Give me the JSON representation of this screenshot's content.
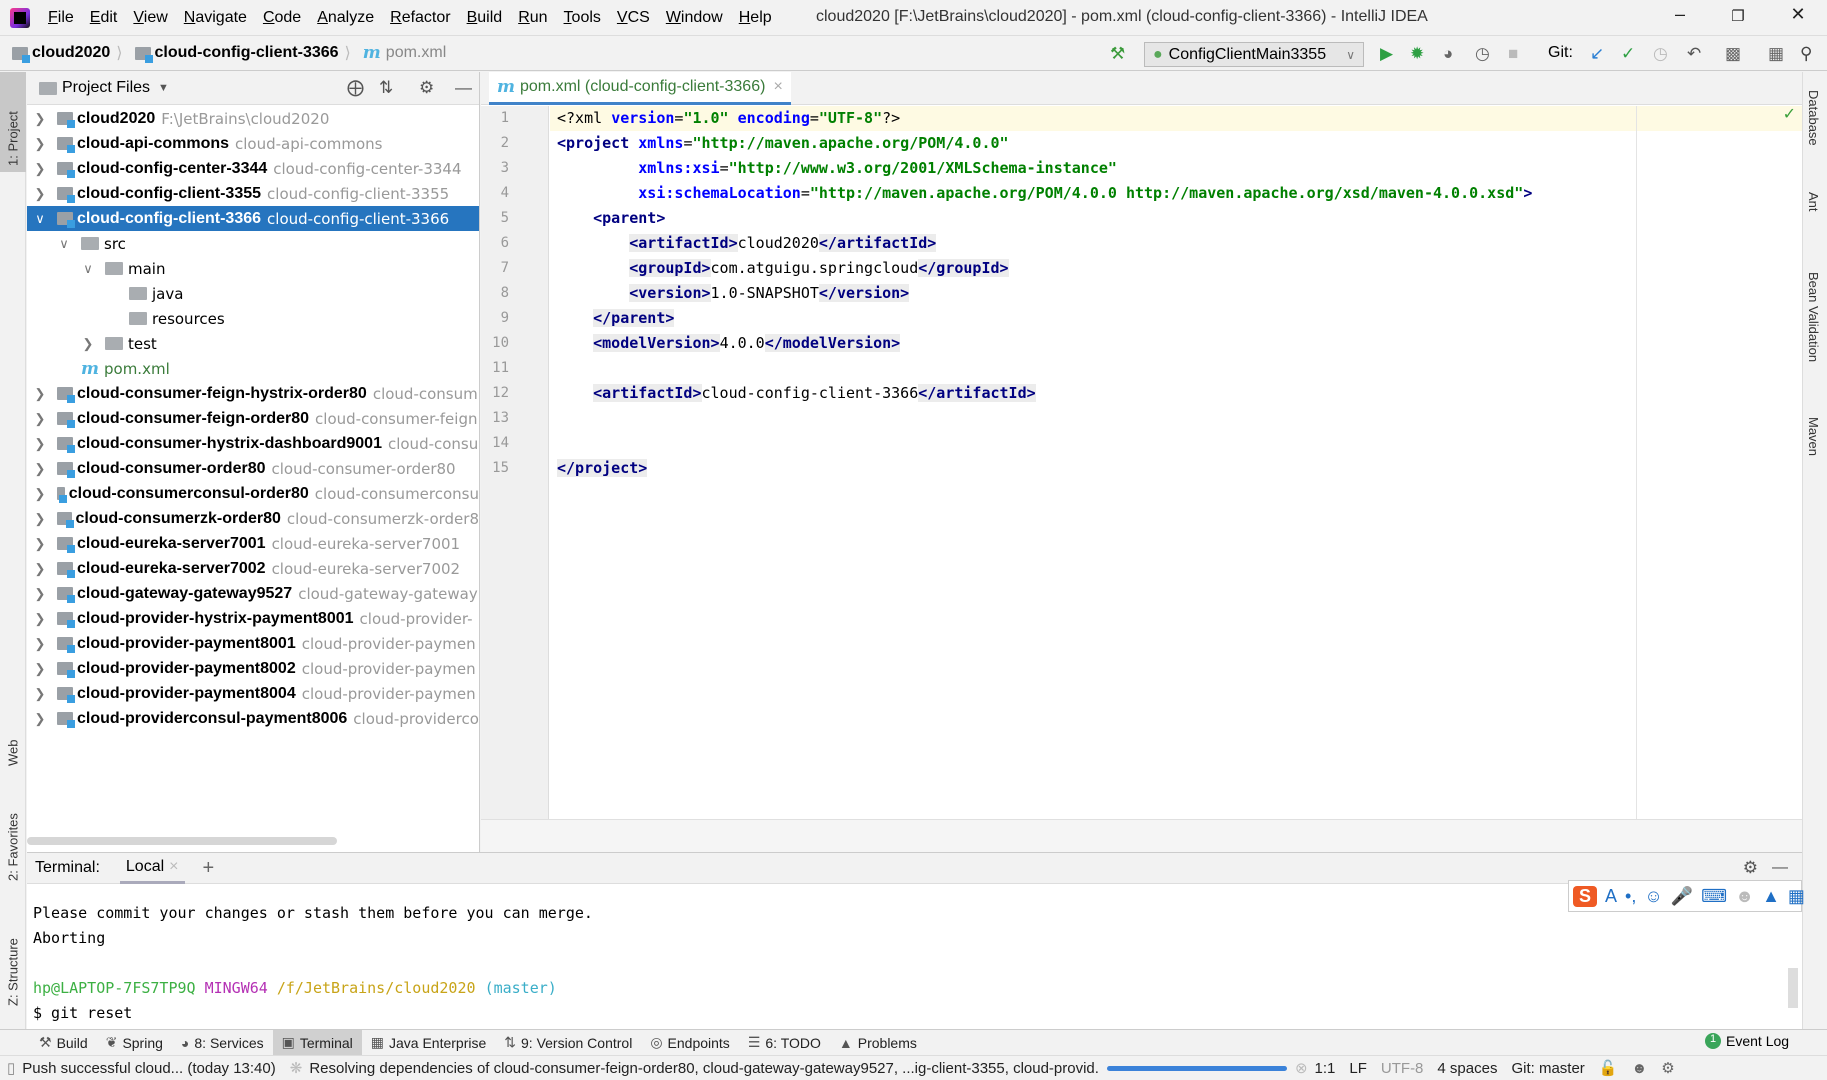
{
  "titlebar": {
    "menus": [
      "File",
      "Edit",
      "View",
      "Navigate",
      "Code",
      "Analyze",
      "Refactor",
      "Build",
      "Run",
      "Tools",
      "VCS",
      "Window",
      "Help"
    ],
    "title": "cloud2020 [F:\\JetBrains\\cloud2020] - pom.xml (cloud-config-client-3366) - IntelliJ IDEA"
  },
  "navbar": {
    "crumbs": [
      "cloud2020",
      "cloud-config-client-3366",
      "pom.xml"
    ],
    "run_config": "ConfigClientMain3355",
    "git_label": "Git:"
  },
  "left_stripe": {
    "project": "1: Project",
    "web": "Web",
    "favorites": "2: Favorites",
    "structure": "Z: Structure"
  },
  "right_stripe": {
    "database": "Database",
    "ant": "Ant",
    "bean": "Bean Validation",
    "maven": "Maven"
  },
  "project": {
    "header": "Project Files",
    "rows": [
      {
        "name": "cloud2020",
        "hint": "F:\\JetBrains\\cloud2020",
        "level": 0,
        "type": "module",
        "expand": "closed"
      },
      {
        "name": "cloud-api-commons",
        "hint": "cloud-api-commons",
        "level": 0,
        "type": "module",
        "expand": "closed"
      },
      {
        "name": "cloud-config-center-3344",
        "hint": "cloud-config-center-3344",
        "level": 0,
        "type": "module",
        "expand": "closed"
      },
      {
        "name": "cloud-config-client-3355",
        "hint": "cloud-config-client-3355",
        "level": 0,
        "type": "module",
        "expand": "closed"
      },
      {
        "name": "cloud-config-client-3366",
        "hint": "cloud-config-client-3366",
        "level": 0,
        "type": "module",
        "expand": "open",
        "selected": true
      },
      {
        "name": "src",
        "level": 1,
        "type": "folder",
        "expand": "open"
      },
      {
        "name": "main",
        "level": 2,
        "type": "folder",
        "expand": "open"
      },
      {
        "name": "java",
        "level": 3,
        "type": "folder"
      },
      {
        "name": "resources",
        "level": 3,
        "type": "folder"
      },
      {
        "name": "test",
        "level": 2,
        "type": "folder",
        "expand": "closed"
      },
      {
        "name": "pom.xml",
        "level": 1,
        "type": "maven"
      },
      {
        "name": "cloud-consumer-feign-hystrix-order80",
        "hint": "cloud-consum",
        "level": 0,
        "type": "module",
        "expand": "closed"
      },
      {
        "name": "cloud-consumer-feign-order80",
        "hint": "cloud-consumer-feign",
        "level": 0,
        "type": "module",
        "expand": "closed"
      },
      {
        "name": "cloud-consumer-hystrix-dashboard9001",
        "hint": "cloud-consu",
        "level": 0,
        "type": "module",
        "expand": "closed"
      },
      {
        "name": "cloud-consumer-order80",
        "hint": "cloud-consumer-order80",
        "level": 0,
        "type": "module",
        "expand": "closed"
      },
      {
        "name": "cloud-consumerconsul-order80",
        "hint": "cloud-consumerconsu",
        "level": 0,
        "type": "module",
        "expand": "closed"
      },
      {
        "name": "cloud-consumerzk-order80",
        "hint": "cloud-consumerzk-order8",
        "level": 0,
        "type": "module",
        "expand": "closed"
      },
      {
        "name": "cloud-eureka-server7001",
        "hint": "cloud-eureka-server7001",
        "level": 0,
        "type": "module",
        "expand": "closed"
      },
      {
        "name": "cloud-eureka-server7002",
        "hint": "cloud-eureka-server7002",
        "level": 0,
        "type": "module",
        "expand": "closed"
      },
      {
        "name": "cloud-gateway-gateway9527",
        "hint": "cloud-gateway-gateway",
        "level": 0,
        "type": "module",
        "expand": "closed"
      },
      {
        "name": "cloud-provider-hystrix-payment8001",
        "hint": "cloud-provider-",
        "level": 0,
        "type": "module",
        "expand": "closed"
      },
      {
        "name": "cloud-provider-payment8001",
        "hint": "cloud-provider-paymen",
        "level": 0,
        "type": "module",
        "expand": "closed"
      },
      {
        "name": "cloud-provider-payment8002",
        "hint": "cloud-provider-paymen",
        "level": 0,
        "type": "module",
        "expand": "closed"
      },
      {
        "name": "cloud-provider-payment8004",
        "hint": "cloud-provider-paymen",
        "level": 0,
        "type": "module",
        "expand": "closed"
      },
      {
        "name": "cloud-providerconsul-payment8006",
        "hint": "cloud-providerco",
        "level": 0,
        "type": "module",
        "expand": "closed"
      }
    ]
  },
  "editor": {
    "tab": "pom.xml (cloud-config-client-3366)",
    "current_line": 1,
    "lines": [
      [
        [
          "<?xml ",
          "t-pi"
        ],
        [
          "version",
          "t-attr"
        ],
        [
          "=",
          "t-pi"
        ],
        [
          "\"1.0\"",
          "t-val"
        ],
        [
          " ",
          "t-pi"
        ],
        [
          "encoding",
          "t-attr"
        ],
        [
          "=",
          "t-pi"
        ],
        [
          "\"UTF-8\"",
          "t-val"
        ],
        [
          "?>",
          "t-pi"
        ]
      ],
      [
        [
          "<project ",
          "t-tag"
        ],
        [
          "xmlns",
          "t-attr"
        ],
        [
          "=",
          "t-txt"
        ],
        [
          "\"http://maven.apache.org/POM/4.0.0\"",
          "t-val"
        ]
      ],
      [
        [
          "         ",
          "t-txt"
        ],
        [
          "xmlns:xsi",
          "t-attr"
        ],
        [
          "=",
          "t-txt"
        ],
        [
          "\"http://www.w3.org/2001/XMLSchema-instance\"",
          "t-val"
        ]
      ],
      [
        [
          "         ",
          "t-txt"
        ],
        [
          "xsi:schemaLocation",
          "t-attr"
        ],
        [
          "=",
          "t-txt"
        ],
        [
          "\"http://maven.apache.org/POM/4.0.0 http://maven.apache.org/xsd/maven-4.0.0.xsd\"",
          "t-val"
        ],
        [
          ">",
          "t-tag"
        ]
      ],
      [
        [
          "    ",
          "t-txt"
        ],
        [
          "<parent>",
          "t-tag"
        ]
      ],
      [
        [
          "        ",
          "t-txt"
        ],
        [
          "<artifactId>",
          "t-tag hl"
        ],
        [
          "cloud2020",
          "t-txt"
        ],
        [
          "</artifactId>",
          "t-tag hl"
        ]
      ],
      [
        [
          "        ",
          "t-txt"
        ],
        [
          "<groupId>",
          "t-tag hl"
        ],
        [
          "com.atguigu.springcloud",
          "t-txt"
        ],
        [
          "</groupId>",
          "t-tag hl"
        ]
      ],
      [
        [
          "        ",
          "t-txt"
        ],
        [
          "<version>",
          "t-tag hl"
        ],
        [
          "1.0-SNAPSHOT",
          "t-txt"
        ],
        [
          "</version>",
          "t-tag hl"
        ]
      ],
      [
        [
          "    ",
          "t-txt"
        ],
        [
          "</parent>",
          "t-tag hl"
        ]
      ],
      [
        [
          "    ",
          "t-txt"
        ],
        [
          "<modelVersion>",
          "t-tag hl"
        ],
        [
          "4.0.0",
          "t-txt"
        ],
        [
          "</modelVersion>",
          "t-tag hl"
        ]
      ],
      [],
      [
        [
          "    ",
          "t-txt"
        ],
        [
          "<artifactId>",
          "t-tag hl"
        ],
        [
          "cloud-config-client-3366",
          "t-txt"
        ],
        [
          "</artifactId>",
          "t-tag hl"
        ]
      ],
      [],
      [],
      [
        [
          "</project>",
          "t-tag hl"
        ]
      ]
    ]
  },
  "terminal": {
    "label": "Terminal:",
    "tab": "Local",
    "lines": [
      "Please commit your changes or stash them before you can merge.",
      "Aborting",
      ""
    ],
    "prompt": {
      "user": "hp@LAPTOP-7FS7TP9Q",
      "env": "MINGW64",
      "path": "/f/JetBrains/cloud2020",
      "branch": "(master)"
    },
    "command": "$ git reset"
  },
  "toolwindows": [
    "Build",
    "Spring",
    "8: Services",
    "Terminal",
    "Java Enterprise",
    "9: Version Control",
    "Endpoints",
    "6: TODO",
    "Problems"
  ],
  "event_log": "Event Log",
  "status": {
    "message": "Push successful cloud... (today 13:40)",
    "task": "Resolving dependencies of cloud-consumer-feign-order80, cloud-gateway-gateway9527, ...ig-client-3355, cloud-provid.",
    "position": "1:1",
    "line_sep": "LF",
    "encoding": "UTF-8",
    "indent": "4 spaces",
    "git": "Git: master"
  },
  "colors": {
    "selection": "#2675bf",
    "accent": "#4083c9",
    "prompt_user": "#3cb043",
    "prompt_env": "#b430b4",
    "prompt_path": "#c8a418",
    "prompt_branch": "#3aaec8"
  }
}
